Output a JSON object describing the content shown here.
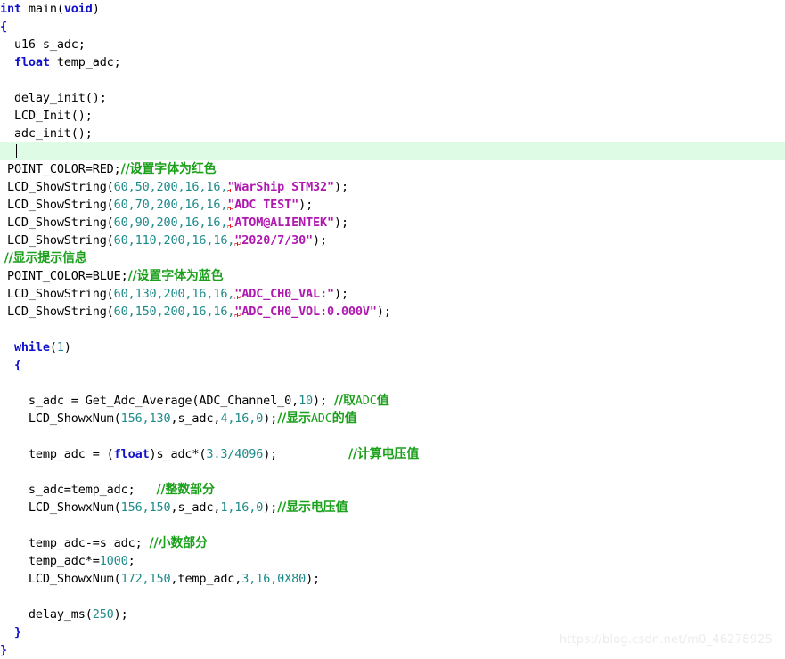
{
  "editor": {
    "language": "c",
    "background_color": "#ffffff",
    "current_line_highlight_color": "#ddfbe5",
    "colors": {
      "keyword": "#1111cc",
      "number": "#1f8a8a",
      "string": "#b019b0",
      "comment": "#1ba01b",
      "plain_text": "#000000",
      "error_squiggle": "#e02020"
    }
  },
  "code": {
    "l01_int": "int",
    "l01_main": " main(",
    "l01_void": "void",
    "l01_close": ")",
    "l02_brace": "{",
    "l03": "  u16 s_adc;",
    "l04_kw": "  float",
    "l04_rest": " temp_adc;",
    "l06": "  delay_init();",
    "l07": "  LCD_Init();",
    "l08": "  adc_init();",
    "l10_code": " POINT_COLOR=RED;",
    "l10_comment": "//设置字体为红色",
    "l11_fn": " LCD_ShowString(",
    "l11_args": "60,50,200,16,16,",
    "l11_str": "\"WarShip STM32\"",
    "l11_tail": ");",
    "l12_fn": " LCD_ShowString(",
    "l12_args": "60,70,200,16,16,",
    "l12_str": "\"ADC TEST\"",
    "l12_tail": ");",
    "l13_fn": " LCD_ShowString(",
    "l13_args": "60,90,200,16,16,",
    "l13_str": "\"ATOM@ALIENTEK\"",
    "l13_tail": ");",
    "l14_fn": " LCD_ShowString(",
    "l14_args": "60,110,200,16,16,",
    "l14_str": "\"2020/7/30\"",
    "l14_tail": ");",
    "l15_comment": " //显示提示信息",
    "l16_code": " POINT_COLOR=BLUE;",
    "l16_comment": "//设置字体为蓝色",
    "l17_fn": " LCD_ShowString(",
    "l17_args": "60,130,200,16,16,",
    "l17_str": "\"ADC_CH0_VAL:\"",
    "l17_tail": ");",
    "l18_fn": " LCD_ShowString(",
    "l18_args": "60,150,200,16,16,",
    "l18_str": "\"ADC_CH0_VOL:0.000V\"",
    "l18_tail": ");",
    "l20_kw": "  while",
    "l20_open": "(",
    "l20_num": "1",
    "l20_close": ")",
    "l21_brace": "  {",
    "l23_code": "    s_adc = Get_Adc_Average(ADC_Channel_0,",
    "l23_num": "10",
    "l23_tail": "); ",
    "l23_comment_cn1": "//取",
    "l23_comment_mono": "ADC",
    "l23_comment_cn2": "值",
    "l24_fn": "    LCD_ShowxNum(",
    "l24_args": "156,130",
    "l24_mid": ",s_adc,",
    "l24_args2": "4,16,0",
    "l24_tail": ");",
    "l24_comment_cn1": "//显示",
    "l24_comment_mono": "ADC",
    "l24_comment_cn2": "的值",
    "l26_pre": "    temp_adc = (",
    "l26_kw": "float",
    "l26_mid": ")s_adc*(",
    "l26_num": "3.3/4096",
    "l26_tail": ");",
    "l26_spacer": "          ",
    "l26_comment": "//计算电压值",
    "l28_code": "    s_adc=temp_adc;   ",
    "l28_comment": "//整数部分",
    "l29_fn": "    LCD_ShowxNum(",
    "l29_args": "156,150",
    "l29_mid": ",s_adc,",
    "l29_args2": "1,16,0",
    "l29_tail": ");",
    "l29_comment": "//显示电压值",
    "l31_code": "    temp_adc-=s_adc; ",
    "l31_comment": "//小数部分",
    "l32_pre": "    temp_adc*=",
    "l32_num": "1000",
    "l32_tail": ";",
    "l33_fn": "    LCD_ShowxNum(",
    "l33_args": "172,150",
    "l33_mid": ",temp_adc,",
    "l33_args2": "3,16,0X80",
    "l33_tail": ");",
    "l35_pre": "    delay_ms(",
    "l35_num": "250",
    "l35_tail": ");",
    "l36_brace": "  }",
    "l37_brace": "}"
  },
  "watermark": {
    "text": "https://blog.csdn.net/m0_46278925"
  }
}
